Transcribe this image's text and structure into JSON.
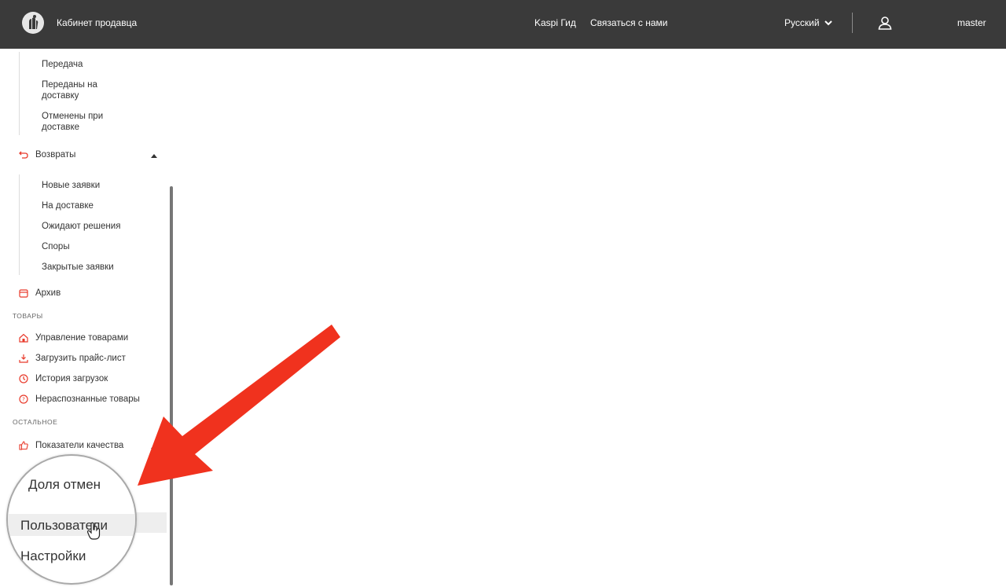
{
  "header": {
    "title": "Кабинет продавца",
    "nav": {
      "guide": "Kaspi Гид",
      "contact": "Связаться с нами"
    },
    "language": "Русский",
    "username": "master",
    "background": "#3a3a3a"
  },
  "sidebar": {
    "delivery_subitems": [
      "Передача",
      "Переданы на доставку",
      "Отменены при доставке"
    ],
    "returns": {
      "label": "Возвраты",
      "icon": "return-arrow-icon",
      "subitems": [
        "Новые заявки",
        "На доставке",
        "Ожидают решения",
        "Споры",
        "Закрытые заявки"
      ]
    },
    "archive": {
      "label": "Архив",
      "icon": "calendar-icon"
    },
    "section_goods": "ТОВАРЫ",
    "goods_items": [
      {
        "label": "Управление товарами",
        "icon": "house-icon"
      },
      {
        "label": "Загрузить прайс-лист",
        "icon": "download-icon"
      },
      {
        "label": "История загрузок",
        "icon": "clock-icon"
      },
      {
        "label": "Нераспознанные товары",
        "icon": "question-icon"
      }
    ],
    "section_other": "ОСТАЛЬНОЕ",
    "quality": {
      "label": "Показатели качества",
      "icon": "thumbs-up-icon"
    }
  },
  "magnifier": {
    "items": [
      "Доля отмен",
      "Пользователи",
      "Настройки"
    ]
  },
  "colors": {
    "accent": "#e8392a",
    "arrow": "#f0321e"
  }
}
